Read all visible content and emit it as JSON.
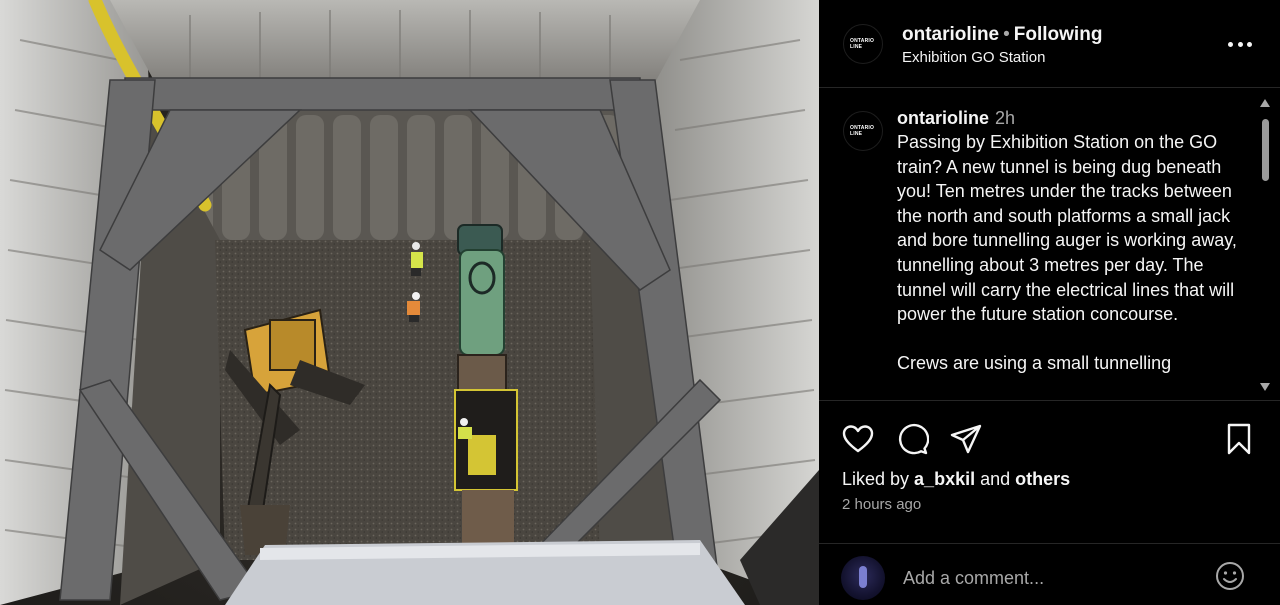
{
  "post": {
    "username": "ontarioline",
    "follow_status": "Following",
    "separator": "•",
    "location": "Exhibition GO Station",
    "avatar_logo_line1": "ONTARIO",
    "avatar_logo_line2": "LINE"
  },
  "caption": {
    "username": "ontarioline",
    "time": "2h",
    "text": "Passing by Exhibition Station on the GO train? A new tunnel is being dug beneath you! Ten metres under the tracks between the north and south platforms a small jack and bore tunnelling auger is working away, tunnelling about 3 metres per day. The tunnel will carry the electrical lines that will power the future station concourse.\n\nCrews are using a small tunnelling"
  },
  "engagement": {
    "liked_prefix": "Liked by ",
    "liked_user": "a_bxkil",
    "liked_and": " and ",
    "liked_others": "others",
    "time_ago": "2 hours ago"
  },
  "comment": {
    "placeholder": "Add a comment..."
  },
  "icons": {
    "more": "more-options-icon",
    "like": "heart-icon",
    "comment": "comment-icon",
    "share": "send-icon",
    "save": "bookmark-icon",
    "emoji": "emoji-icon"
  },
  "colors": {
    "background": "#000000",
    "text_primary": "#f5f5f5",
    "text_secondary": "#a8a8a8",
    "divider": "#262626"
  }
}
